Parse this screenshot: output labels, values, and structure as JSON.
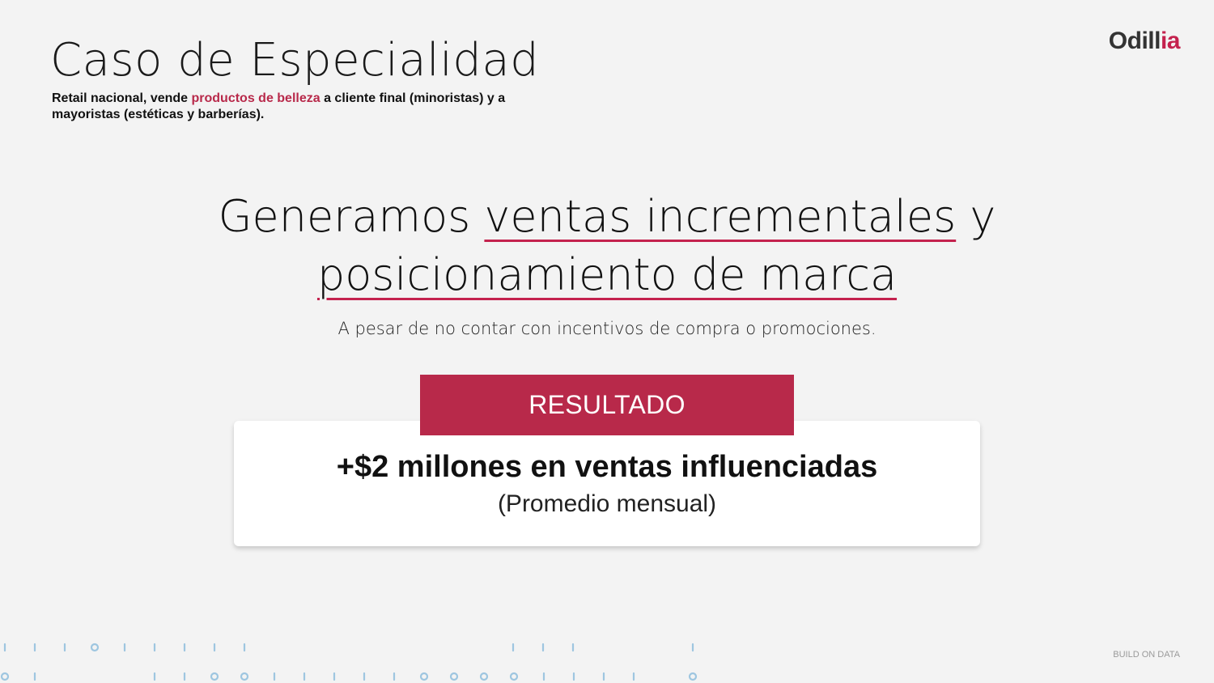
{
  "header": {
    "title": "Caso de Especialidad",
    "subtitle_part1": "Retail nacional, vende ",
    "subtitle_highlight": "productos de belleza",
    "subtitle_part2": " a cliente final (minoristas) y a mayoristas (estéticas y barberías)."
  },
  "logo": {
    "main": "Odill",
    "accent": "ia"
  },
  "headline": {
    "part1": "Generamos ",
    "underlined1": "ventas incrementales",
    "part2": " y",
    "underlined2": "posicionamiento de marca"
  },
  "lead": "A pesar de no contar con incentivos de compra o promociones.",
  "result": {
    "badge": "RESULTADO",
    "main": "+$2 millones  en ventas influenciadas",
    "sub": "(Promedio mensual)"
  },
  "footer": "BUILD ON DATA",
  "colors": {
    "accent": "#b8294a",
    "background": "#f3f3f3",
    "decoration": "#9ec6e0"
  }
}
